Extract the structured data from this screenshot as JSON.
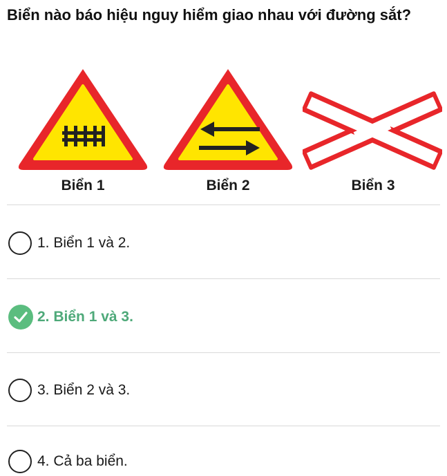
{
  "question": "Biển nào báo hiệu nguy hiểm giao nhau với đường sắt?",
  "signs": [
    {
      "label": "Biển 1",
      "icon": "railway-fence-warning-sign-icon"
    },
    {
      "label": "Biển 2",
      "icon": "two-way-arrows-warning-sign-icon"
    },
    {
      "label": "Biển 3",
      "icon": "railway-crossbuck-sign-icon"
    }
  ],
  "options": [
    {
      "text": "1. Biển 1 và 2.",
      "selected": false
    },
    {
      "text": "2. Biển 1 và 3.",
      "selected": true
    },
    {
      "text": "3. Biển 2 và 3.",
      "selected": false
    },
    {
      "text": "4. Cả ba biển.",
      "selected": false
    }
  ],
  "colors": {
    "sign_border": "#e8262a",
    "sign_fill": "#ffe500",
    "correct_answer": "#4ea979",
    "check_badge": "#5bbd7f"
  }
}
